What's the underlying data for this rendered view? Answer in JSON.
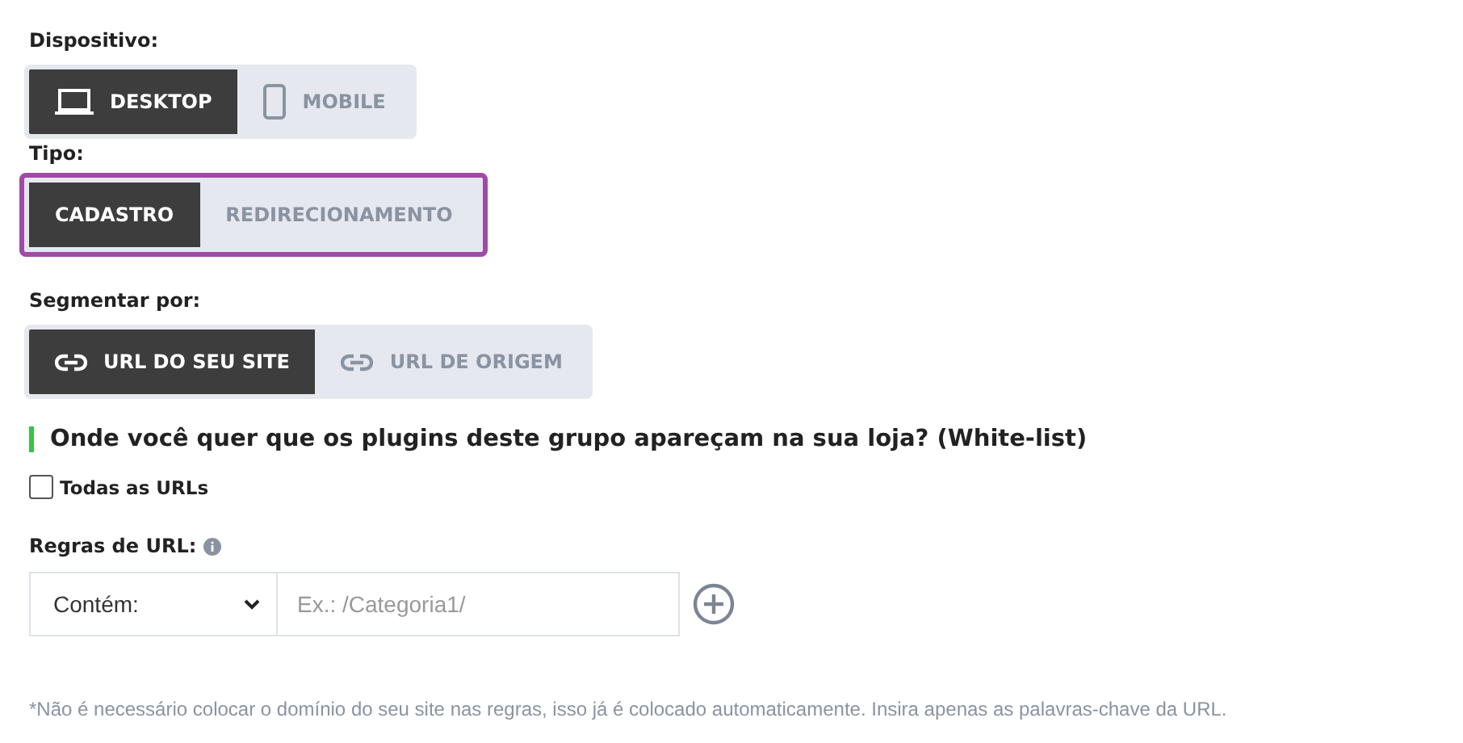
{
  "groups": [
    {
      "label": "Dispositivo:",
      "highlighted": false,
      "options": [
        {
          "label": "DESKTOP",
          "kind": "laptop",
          "selected": true
        },
        {
          "label": "MOBILE",
          "kind": "phone",
          "selected": false
        }
      ]
    },
    {
      "label": "Tipo:",
      "highlighted": true,
      "options": [
        {
          "label": "CADASTRO",
          "selected": true
        },
        {
          "label": "REDIRECIONAMENTO",
          "selected": false
        }
      ]
    },
    {
      "label": "Segmentar por:",
      "highlighted": false,
      "options": [
        {
          "label": "URL DO SEU SITE",
          "kind": "link",
          "selected": true
        },
        {
          "label": "URL DE ORIGEM",
          "kind": "link",
          "selected": false
        }
      ]
    }
  ],
  "section_title": "Onde você quer que os plugins deste grupo apareçam na sua loja? (White-list)",
  "all_urls": {
    "label": "Todas as URLs",
    "checked": false
  },
  "rules": {
    "label": "Regras de URL:",
    "condition": "Contém:",
    "placeholder": "Ex.: /Categoria1/"
  },
  "footnote": "*Não é necessário colocar o domínio do seu site nas regras, isso já é colocado automaticamente. Insira apenas as palavras-chave da URL."
}
